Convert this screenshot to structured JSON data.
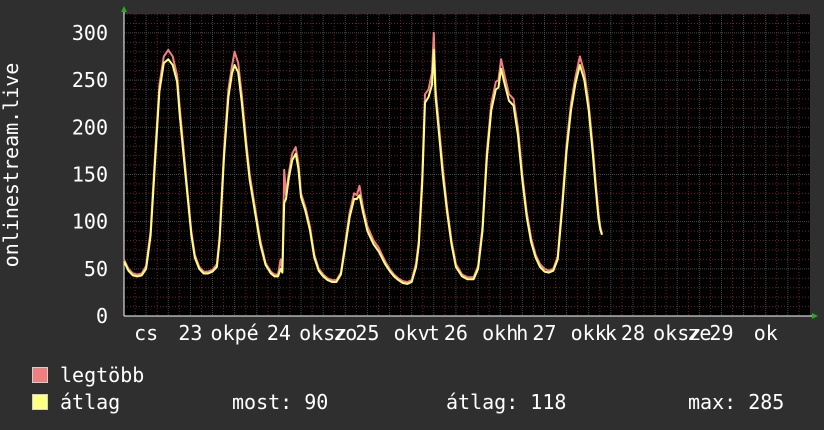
{
  "chart_data": {
    "type": "line",
    "ylabel": "onlinestream.live",
    "ylim": [
      0,
      320
    ],
    "yticks": [
      0,
      50,
      100,
      150,
      200,
      250,
      300
    ],
    "grid": true,
    "x_range": [
      0,
      7.75
    ],
    "x_tick_labels": [
      {
        "x": 0.25,
        "label": "cs"
      },
      {
        "x": 0.75,
        "label": "23"
      },
      {
        "x": 1.25,
        "label": "okpé"
      },
      {
        "x": 1.75,
        "label": "24"
      },
      {
        "x": 2.25,
        "label": "oksz"
      },
      {
        "x": 2.5,
        "label": "zo"
      },
      {
        "x": 2.75,
        "label": "25"
      },
      {
        "x": 3.25,
        "label": "okv"
      },
      {
        "x": 3.5,
        "label": "t"
      },
      {
        "x": 3.75,
        "label": "26"
      },
      {
        "x": 4.25,
        "label": "okh"
      },
      {
        "x": 4.5,
        "label": "h"
      },
      {
        "x": 4.75,
        "label": "27"
      },
      {
        "x": 5.25,
        "label": "okk"
      },
      {
        "x": 5.5,
        "label": "k"
      },
      {
        "x": 5.75,
        "label": "28"
      },
      {
        "x": 6.25,
        "label": "oksz"
      },
      {
        "x": 6.5,
        "label": "ze"
      },
      {
        "x": 6.75,
        "label": "29"
      },
      {
        "x": 7.25,
        "label": "ok"
      }
    ],
    "series": [
      {
        "name": "legtöbb",
        "color": "#f08080",
        "points": [
          [
            0.0,
            60
          ],
          [
            0.05,
            50
          ],
          [
            0.1,
            45
          ],
          [
            0.15,
            44
          ],
          [
            0.2,
            45
          ],
          [
            0.25,
            53
          ],
          [
            0.3,
            90
          ],
          [
            0.35,
            170
          ],
          [
            0.4,
            245
          ],
          [
            0.45,
            275
          ],
          [
            0.5,
            282
          ],
          [
            0.55,
            275
          ],
          [
            0.6,
            255
          ],
          [
            0.63,
            220
          ],
          [
            0.68,
            170
          ],
          [
            0.72,
            130
          ],
          [
            0.76,
            90
          ],
          [
            0.8,
            65
          ],
          [
            0.85,
            52
          ],
          [
            0.9,
            47
          ],
          [
            0.95,
            47
          ],
          [
            1.0,
            49
          ],
          [
            1.05,
            55
          ],
          [
            1.08,
            85
          ],
          [
            1.13,
            175
          ],
          [
            1.18,
            240
          ],
          [
            1.22,
            265
          ],
          [
            1.25,
            280
          ],
          [
            1.29,
            268
          ],
          [
            1.33,
            235
          ],
          [
            1.38,
            185
          ],
          [
            1.42,
            150
          ],
          [
            1.48,
            115
          ],
          [
            1.54,
            80
          ],
          [
            1.6,
            56
          ],
          [
            1.66,
            47
          ],
          [
            1.7,
            44
          ],
          [
            1.74,
            44
          ],
          [
            1.77,
            60
          ],
          [
            1.79,
            48
          ],
          [
            1.81,
            155
          ],
          [
            1.83,
            128
          ],
          [
            1.86,
            150
          ],
          [
            1.9,
            172
          ],
          [
            1.94,
            179
          ],
          [
            1.97,
            162
          ],
          [
            2.0,
            130
          ],
          [
            2.05,
            115
          ],
          [
            2.1,
            95
          ],
          [
            2.15,
            65
          ],
          [
            2.2,
            50
          ],
          [
            2.25,
            44
          ],
          [
            2.3,
            40
          ],
          [
            2.35,
            38
          ],
          [
            2.4,
            38
          ],
          [
            2.45,
            46
          ],
          [
            2.5,
            78
          ],
          [
            2.55,
            110
          ],
          [
            2.6,
            130
          ],
          [
            2.63,
            128
          ],
          [
            2.66,
            138
          ],
          [
            2.7,
            115
          ],
          [
            2.75,
            95
          ],
          [
            2.82,
            80
          ],
          [
            2.88,
            72
          ],
          [
            2.95,
            58
          ],
          [
            3.0,
            50
          ],
          [
            3.05,
            44
          ],
          [
            3.1,
            40
          ],
          [
            3.15,
            37
          ],
          [
            3.2,
            36
          ],
          [
            3.25,
            38
          ],
          [
            3.3,
            56
          ],
          [
            3.33,
            80
          ],
          [
            3.37,
            150
          ],
          [
            3.4,
            235
          ],
          [
            3.44,
            240
          ],
          [
            3.48,
            258
          ],
          [
            3.5,
            300
          ],
          [
            3.52,
            240
          ],
          [
            3.56,
            200
          ],
          [
            3.6,
            158
          ],
          [
            3.65,
            115
          ],
          [
            3.7,
            80
          ],
          [
            3.75,
            55
          ],
          [
            3.82,
            44
          ],
          [
            3.88,
            41
          ],
          [
            3.95,
            41
          ],
          [
            4.0,
            53
          ],
          [
            4.05,
            95
          ],
          [
            4.1,
            175
          ],
          [
            4.15,
            225
          ],
          [
            4.2,
            248
          ],
          [
            4.23,
            250
          ],
          [
            4.26,
            272
          ],
          [
            4.3,
            255
          ],
          [
            4.35,
            235
          ],
          [
            4.4,
            230
          ],
          [
            4.45,
            200
          ],
          [
            4.5,
            150
          ],
          [
            4.55,
            110
          ],
          [
            4.6,
            82
          ],
          [
            4.65,
            65
          ],
          [
            4.7,
            55
          ],
          [
            4.75,
            50
          ],
          [
            4.8,
            48
          ],
          [
            4.85,
            50
          ],
          [
            4.9,
            63
          ],
          [
            4.95,
            120
          ],
          [
            5.0,
            182
          ],
          [
            5.05,
            225
          ],
          [
            5.1,
            253
          ],
          [
            5.15,
            275
          ],
          [
            5.2,
            258
          ],
          [
            5.25,
            225
          ],
          [
            5.3,
            175
          ],
          [
            5.33,
            140
          ],
          [
            5.36,
            110
          ],
          [
            5.38,
            95
          ],
          [
            5.4,
            87
          ]
        ]
      },
      {
        "name": "átlag",
        "color": "#ffff80",
        "points": [
          [
            0.0,
            58
          ],
          [
            0.05,
            48
          ],
          [
            0.1,
            43
          ],
          [
            0.15,
            42
          ],
          [
            0.2,
            43
          ],
          [
            0.25,
            50
          ],
          [
            0.3,
            85
          ],
          [
            0.35,
            162
          ],
          [
            0.4,
            238
          ],
          [
            0.45,
            268
          ],
          [
            0.5,
            272
          ],
          [
            0.55,
            266
          ],
          [
            0.6,
            248
          ],
          [
            0.63,
            212
          ],
          [
            0.68,
            163
          ],
          [
            0.72,
            125
          ],
          [
            0.76,
            86
          ],
          [
            0.8,
            62
          ],
          [
            0.85,
            50
          ],
          [
            0.9,
            45
          ],
          [
            0.95,
            45
          ],
          [
            1.0,
            47
          ],
          [
            1.05,
            52
          ],
          [
            1.08,
            80
          ],
          [
            1.13,
            168
          ],
          [
            1.18,
            232
          ],
          [
            1.22,
            257
          ],
          [
            1.25,
            266
          ],
          [
            1.29,
            258
          ],
          [
            1.33,
            227
          ],
          [
            1.38,
            178
          ],
          [
            1.42,
            144
          ],
          [
            1.48,
            110
          ],
          [
            1.54,
            76
          ],
          [
            1.6,
            54
          ],
          [
            1.66,
            45
          ],
          [
            1.7,
            42
          ],
          [
            1.74,
            42
          ],
          [
            1.77,
            50
          ],
          [
            1.79,
            46
          ],
          [
            1.81,
            120
          ],
          [
            1.83,
            124
          ],
          [
            1.86,
            145
          ],
          [
            1.9,
            165
          ],
          [
            1.94,
            172
          ],
          [
            1.97,
            156
          ],
          [
            2.0,
            126
          ],
          [
            2.05,
            111
          ],
          [
            2.1,
            91
          ],
          [
            2.15,
            62
          ],
          [
            2.2,
            48
          ],
          [
            2.25,
            42
          ],
          [
            2.3,
            38
          ],
          [
            2.35,
            36
          ],
          [
            2.4,
            36
          ],
          [
            2.45,
            44
          ],
          [
            2.5,
            74
          ],
          [
            2.55,
            105
          ],
          [
            2.6,
            124
          ],
          [
            2.63,
            124
          ],
          [
            2.66,
            128
          ],
          [
            2.7,
            110
          ],
          [
            2.75,
            90
          ],
          [
            2.82,
            76
          ],
          [
            2.88,
            68
          ],
          [
            2.95,
            55
          ],
          [
            3.0,
            48
          ],
          [
            3.05,
            42
          ],
          [
            3.1,
            38
          ],
          [
            3.15,
            35
          ],
          [
            3.2,
            34
          ],
          [
            3.25,
            36
          ],
          [
            3.3,
            52
          ],
          [
            3.33,
            75
          ],
          [
            3.37,
            142
          ],
          [
            3.4,
            226
          ],
          [
            3.44,
            232
          ],
          [
            3.48,
            245
          ],
          [
            3.5,
            282
          ],
          [
            3.52,
            232
          ],
          [
            3.56,
            192
          ],
          [
            3.6,
            150
          ],
          [
            3.65,
            110
          ],
          [
            3.7,
            76
          ],
          [
            3.75,
            52
          ],
          [
            3.82,
            42
          ],
          [
            3.88,
            39
          ],
          [
            3.95,
            39
          ],
          [
            4.0,
            50
          ],
          [
            4.05,
            90
          ],
          [
            4.1,
            168
          ],
          [
            4.15,
            218
          ],
          [
            4.2,
            240
          ],
          [
            4.23,
            242
          ],
          [
            4.26,
            262
          ],
          [
            4.3,
            246
          ],
          [
            4.35,
            228
          ],
          [
            4.4,
            223
          ],
          [
            4.45,
            192
          ],
          [
            4.5,
            144
          ],
          [
            4.55,
            105
          ],
          [
            4.6,
            78
          ],
          [
            4.65,
            62
          ],
          [
            4.7,
            52
          ],
          [
            4.75,
            47
          ],
          [
            4.8,
            46
          ],
          [
            4.85,
            48
          ],
          [
            4.9,
            60
          ],
          [
            4.95,
            114
          ],
          [
            5.0,
            175
          ],
          [
            5.05,
            218
          ],
          [
            5.1,
            246
          ],
          [
            5.15,
            266
          ],
          [
            5.2,
            250
          ],
          [
            5.25,
            218
          ],
          [
            5.3,
            168
          ],
          [
            5.33,
            134
          ],
          [
            5.36,
            104
          ],
          [
            5.38,
            92
          ],
          [
            5.4,
            86
          ]
        ]
      }
    ]
  },
  "legend": [
    {
      "label": "legtöbb",
      "color": "#f08080"
    },
    {
      "label": "átlag",
      "color": "#ffff80"
    }
  ],
  "stats": {
    "now_label": "most: 90",
    "avg_label": "átlag: 118",
    "max_label": "max: 285"
  },
  "colors": {
    "background": "#2f2f2f",
    "plot_background": "#000000",
    "grid": "#4a4a4a",
    "minor_grid_red": "#7a2020",
    "text": "#ffffff",
    "axis_arrow": "#22aa22"
  }
}
